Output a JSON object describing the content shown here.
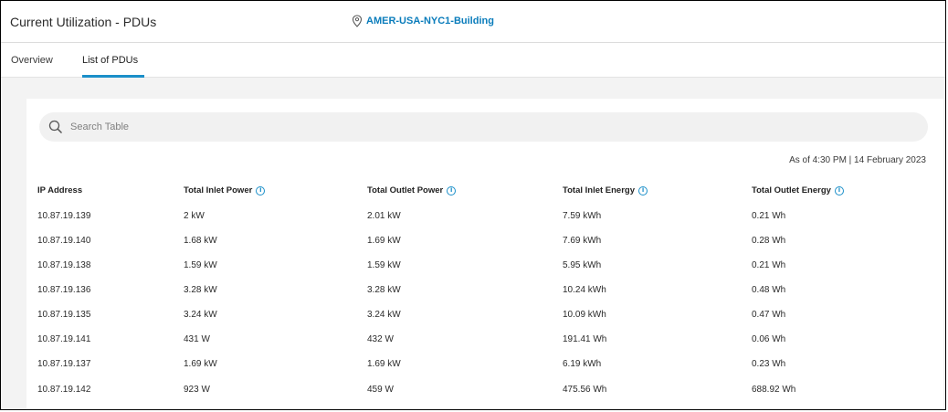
{
  "header": {
    "title": "Current Utilization - PDUs",
    "location": "AMER-USA-NYC1-Building",
    "location_icon": "location-pin-icon"
  },
  "tabs": [
    {
      "label": "Overview",
      "active": false
    },
    {
      "label": "List of PDUs",
      "active": true
    }
  ],
  "search": {
    "placeholder": "Search Table",
    "value": ""
  },
  "timestamp": "As of 4:30 PM | 14 February 2023",
  "table": {
    "columns": [
      "IP Address",
      "Total Inlet Power",
      "Total Outlet Power",
      "Total Inlet Energy",
      "Total Outlet Energy"
    ],
    "rows": [
      [
        "10.87.19.139",
        "2 kW",
        "2.01 kW",
        "7.59 kWh",
        "0.21 Wh"
      ],
      [
        "10.87.19.140",
        "1.68 kW",
        "1.69 kW",
        "7.69 kWh",
        "0.28 Wh"
      ],
      [
        "10.87.19.138",
        "1.59 kW",
        "1.59 kW",
        "5.95 kWh",
        "0.21 Wh"
      ],
      [
        "10.87.19.136",
        "3.28 kW",
        "3.28 kW",
        "10.24 kWh",
        "0.48 Wh"
      ],
      [
        "10.87.19.135",
        "3.24 kW",
        "3.24 kW",
        "10.09 kWh",
        "0.47 Wh"
      ],
      [
        "10.87.19.141",
        "431 W",
        "432 W",
        "191.41 Wh",
        "0.06 Wh"
      ],
      [
        "10.87.19.137",
        "1.69 kW",
        "1.69 kW",
        "6.19 kWh",
        "0.23 Wh"
      ],
      [
        "10.87.19.142",
        "923 W",
        "459 W",
        "475.56 Wh",
        "688.92 Wh"
      ]
    ]
  },
  "colors": {
    "accent": "#1b8fc9",
    "location_text": "#0a7cbb",
    "background": "#f3f3f3"
  }
}
